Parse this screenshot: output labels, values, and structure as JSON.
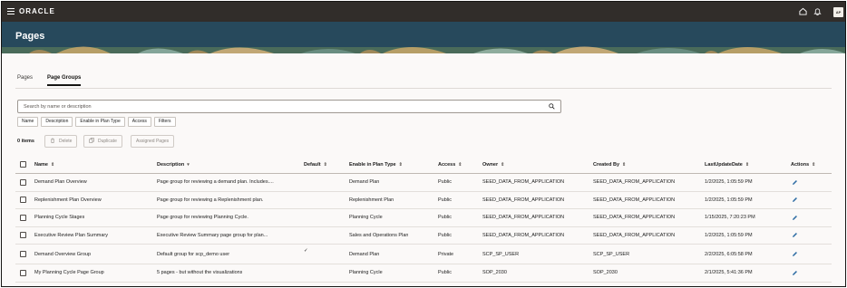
{
  "topbar": {
    "brand": "ORACLE",
    "user_initials": "AP",
    "icons": [
      "menu-icon",
      "home-icon",
      "notifications-icon"
    ]
  },
  "page": {
    "title": "Pages"
  },
  "tabs": [
    {
      "label": "Pages",
      "active": false
    },
    {
      "label": "Page Groups",
      "active": true
    }
  ],
  "search": {
    "placeholder": "Search by name or description",
    "value": ""
  },
  "filter_chips": [
    "Name",
    "Description",
    "Enable in Plan Type",
    "Access",
    "Filters"
  ],
  "toolbar": {
    "items_count": "0 items",
    "delete_label": "Delete",
    "duplicate_label": "Duplicate",
    "assigned_pages_label": "Assigned Pages"
  },
  "table": {
    "columns": {
      "name": "Name",
      "description": "Description",
      "default": "Default",
      "enable_in_plan_type": "Enable in Plan Type",
      "access": "Access",
      "owner": "Owner",
      "created_by": "Created By",
      "last_update_date": "LastUpdateDate",
      "actions": "Actions"
    },
    "rows": [
      {
        "name": "Demand Plan Overview",
        "description": "Page group for reviewing a demand plan. Includes....",
        "default": "",
        "plan_type": "Demand Plan",
        "access": "Public",
        "owner": "SEED_DATA_FROM_APPLICATION",
        "created_by": "SEED_DATA_FROM_APPLICATION",
        "date": "1/2/2025, 1:05:59 PM"
      },
      {
        "name": "Replenishment Plan Overview",
        "description": "Page group for reviewing a Replenishment plan.",
        "default": "",
        "plan_type": "Replenishment Plan",
        "access": "Public",
        "owner": "SEED_DATA_FROM_APPLICATION",
        "created_by": "SEED_DATA_FROM_APPLICATION",
        "date": "1/2/2025, 1:05:59 PM"
      },
      {
        "name": "Planning Cycle Stages",
        "description": "Page group for reviewing Planning Cycle.",
        "default": "",
        "plan_type": "Planning Cycle",
        "access": "Public",
        "owner": "SEED_DATA_FROM_APPLICATION",
        "created_by": "SEED_DATA_FROM_APPLICATION",
        "date": "1/15/2025, 7:20:23 PM"
      },
      {
        "name": "Executive Review Plan Summary",
        "description": "Executive Review Summary page group for plan...",
        "default": "",
        "plan_type": "Sales and Operations Plan",
        "access": "Public",
        "owner": "SEED_DATA_FROM_APPLICATION",
        "created_by": "SEED_DATA_FROM_APPLICATION",
        "date": "1/2/2025, 1:05:59 PM"
      },
      {
        "name": "Demand Overview Group",
        "description": "Default group for scp_demo user",
        "default": "✓",
        "plan_type": "Demand Plan",
        "access": "Private",
        "owner": "SCP_SP_USER",
        "created_by": "SCP_SP_USER",
        "date": "2/2/2025, 6:05:58 PM"
      },
      {
        "name": "My Planning Cycle Page Group",
        "description": "5 pages - but without the visualizations",
        "default": "",
        "plan_type": "Planning Cycle",
        "access": "Public",
        "owner": "SOP_2030",
        "created_by": "SOP_2030",
        "date": "2/1/2025, 5:41:36 PM"
      }
    ]
  },
  "colors": {
    "topbar": "#312d2a",
    "banner": "#27495c",
    "accent_edit": "#2e6da4",
    "background": "#fbf9f8"
  }
}
